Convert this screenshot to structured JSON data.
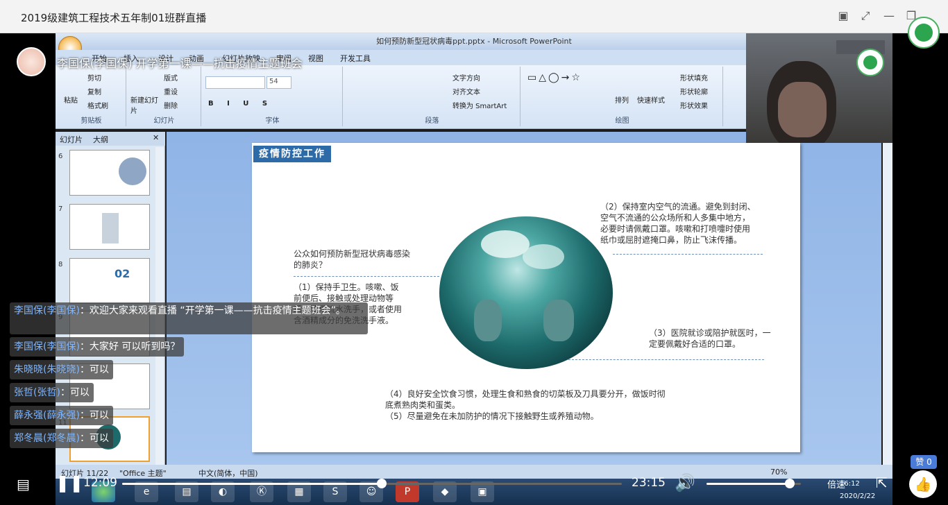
{
  "window": {
    "title": "2019级建筑工程技术五年制01班群直播"
  },
  "ppt": {
    "title": "如何预防新型冠状病毒ppt.pptx - Microsoft PowerPoint",
    "tabs": [
      "开始",
      "插入",
      "设计",
      "动画",
      "幻灯片放映",
      "审阅",
      "视图",
      "开发工具"
    ],
    "groups": {
      "clipboard": {
        "label": "剪贴板",
        "paste": "粘贴",
        "cut": "剪切",
        "copy": "复制",
        "format": "格式刷"
      },
      "slides": {
        "label": "幻灯片",
        "new": "新建幻灯片",
        "layout": "版式",
        "reset": "重设",
        "delete": "删除"
      },
      "font": {
        "label": "字体",
        "size": "54"
      },
      "paragraph": {
        "label": "段落",
        "dir": "文字方向",
        "align": "对齐文本",
        "smartart": "转换为 SmartArt"
      },
      "drawing": {
        "label": "绘图",
        "arrange": "排列",
        "quickstyle": "快速样式",
        "fill": "形状填充",
        "outline": "形状轮廓",
        "effect": "形状效果"
      }
    },
    "sidebar_tabs": [
      "幻灯片",
      "大纲"
    ],
    "thumb_numbers": [
      "6",
      "7",
      "8",
      "9",
      "10",
      "11"
    ],
    "thumb2_text": "02",
    "slide": {
      "title": "疫情防控工作",
      "q": "公众如何预防新型冠状病毒感染的肺炎？",
      "p1": "（1）保持手卫生。咳嗽、饭前便后、接触或处理动物等后，要用流水洗手，或者使用含酒精成分的免洗洗手液。",
      "p2": "（2）保持室内空气的流通。避免到封闭、空气不流通的公众场所和人多集中地方，必要时请佩戴口罩。咳嗽和打喷嚏时使用纸巾或屈肘遮掩口鼻，防止飞沫传播。",
      "p3": "（3）医院就诊或陪护就医时，一定要佩戴好合适的口罩。",
      "p4": "（4）良好安全饮食习惯，处理生食和熟食的切菜板及刀具要分开，做饭时彻底煮熟肉类和蛋类。",
      "p5": "（5）尽量避免在未加防护的情况下接触野生或养殖动物。"
    },
    "status": {
      "slide": "幻灯片 11/22",
      "theme": "\"Office 主题\"",
      "lang": "中文(简体，中国)",
      "zoom": "70%"
    },
    "clock": {
      "time": "16:12",
      "date": "2020/2/22"
    }
  },
  "overlay": {
    "course_title": "李国保(李国保) 开学第一课——抗击疫情主题班会"
  },
  "chat": [
    {
      "who": "李国保(李国保)",
      "msg": "：欢迎大家来观看直播 “开学第一课——抗击疫情主题班会”。"
    },
    {
      "who": "李国保(李国保)",
      "msg": "：大家好 可以听到吗？"
    },
    {
      "who": "朱晓晓(朱晓晓)",
      "msg": "：可以"
    },
    {
      "who": "张哲(张哲)",
      "msg": "：可以"
    },
    {
      "who": "薛永强(薛永强)",
      "msg": "：可以"
    },
    {
      "who": "郑冬晨(郑冬晨)",
      "msg": "：可以"
    }
  ],
  "player": {
    "current": "12:09",
    "total": "23:15",
    "speed": "倍速",
    "like_label": "赞 0",
    "progress": 0.52,
    "volume": 0.88
  }
}
